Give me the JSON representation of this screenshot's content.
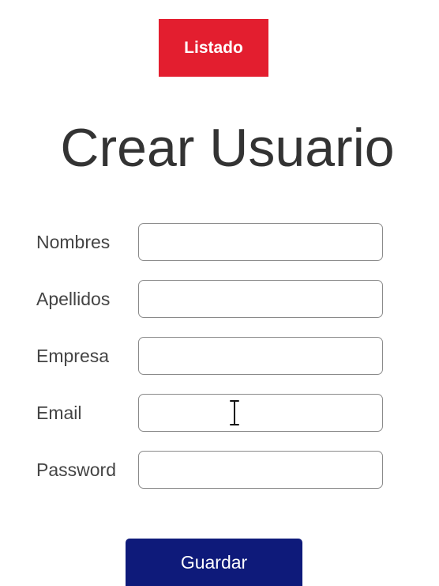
{
  "header": {
    "listado_label": "Listado"
  },
  "main": {
    "title": "Crear Usuario"
  },
  "form": {
    "fields": [
      {
        "label": "Nombres",
        "value": "",
        "placeholder": ""
      },
      {
        "label": "Apellidos",
        "value": "",
        "placeholder": ""
      },
      {
        "label": "Empresa",
        "value": "",
        "placeholder": ""
      },
      {
        "label": "Email",
        "value": "",
        "placeholder": ""
      },
      {
        "label": "Password",
        "value": "",
        "placeholder": ""
      }
    ],
    "submit_label": "Guardar"
  },
  "colors": {
    "listado_bg": "#e31e2f",
    "guardar_bg": "#0e1a7a"
  },
  "icons": {
    "cursor": "text-cursor-icon"
  }
}
